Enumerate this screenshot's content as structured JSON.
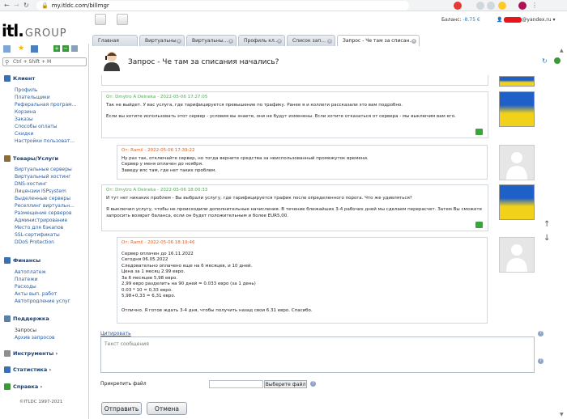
{
  "browser": {
    "url": "my.itldc.com/billmgr"
  },
  "header": {
    "logo_main": "itl.",
    "logo_group": "GROUP",
    "balance_label": "Баланс:",
    "balance_value": "-8.75 €",
    "user_email_suffix": "@yandex.ru"
  },
  "tabs": [
    {
      "label": "Главная"
    },
    {
      "label": "Виртуальны..."
    },
    {
      "label": "Виртуальны..."
    },
    {
      "label": "Профиль кл..."
    },
    {
      "label": "Список зап..."
    },
    {
      "label": "Запрос - Че там за списан..."
    }
  ],
  "sidebar": {
    "search_placeholder": "Ctrl + Shift + M",
    "sections": [
      {
        "title": "Клиент",
        "items": [
          "Профиль",
          "Плательщики",
          "Реферальная програм...",
          "Корзина",
          "Заказы",
          "Способы оплаты",
          "Скидки",
          "Настройки пользоват..."
        ]
      },
      {
        "title": "Товары/Услуги",
        "items": [
          "Виртуальные серверы",
          "Виртуальный хостинг",
          "DNS-хостинг",
          "Лицензии ISPsystem",
          "Выделенные серверы",
          "Реселлинг виртуальн...",
          "Размещение серверов",
          "Администрирование",
          "Место для бэкапов",
          "SSL-сертификаты",
          "DDoS Protection"
        ]
      },
      {
        "title": "Финансы",
        "items": [
          "Автоплатеж",
          "Платежи",
          "Расходы",
          "Акты вып. работ",
          "Автопродление услуг"
        ]
      },
      {
        "title": "Поддержка",
        "items": [
          "Запросы",
          "Архив запросов"
        ]
      },
      {
        "title": "Инструменты ›",
        "items": []
      },
      {
        "title": "Статистика ›",
        "items": []
      },
      {
        "title": "Справка ›",
        "items": []
      }
    ],
    "copyright": "©ITLDC 1997-2021"
  },
  "ticket": {
    "title": "Запрос - Че там за списания начались?",
    "messages": [
      {
        "header": "От: Dmytro A Deineka - 2022-05-06 17:27:05",
        "lines": [
          "Так не выйдет. У вас услуга, где тарифицируется превышение по трафику. Ранее я и коллеги рассказали это вам подробно.",
          "",
          "Если вы хотите использовать этот сервер - условия вы знаете, они не будут изменены. Если хотите отказаться от сервера - мы выключим вам его."
        ]
      },
      {
        "header": "От: Ramil - 2022-05-06 17:39:22",
        "lines": [
          "Ну раз так, отключайте сервер, но тогда верните средства за неиспользованный промежуток времени.",
          "Сервер у меня оплачен до ноября.",
          "Заведу впс там, где нет таких проблем."
        ]
      },
      {
        "header": "От: Dmytro A Deineka - 2022-05-06 18:00:33",
        "lines": [
          "И тут нет никаких проблем - Вы выбрали услугу, где тарифицируется трафик после определенного порога. Что же удивляться?",
          "",
          "Я выключил услугу, чтобы не происходили дополнительные начисления. В течение ближайших 3-4 рабочих дней мы сделаем перерасчет. Затем Вы сможете",
          "запросить возврат баланса, если он будет положительным и более EUR5,00."
        ]
      },
      {
        "header": "От: Ramil - 2022-05-06 18:19:46",
        "lines": [
          "Сервер оплачен до 16.11.2022",
          "Сегодня 06.05.2022",
          "Следовательно оплачено еще на 6 месяцев, и 10 дней.",
          "Цена за 1 месяц 2.99 евро.",
          "За 6 месяцев 5,98 евро.",
          "2,99 евро разделить на 90 дней = 0.033 евро (за 1 день)",
          "0.03 * 10 = 0,33 евро.",
          "5,98+0,33 = 6,31 евро.",
          "",
          "Отлично. Я готов ждать 3-4 дня, чтобы получить назад свои 6.31 евро. Спасибо."
        ]
      }
    ],
    "cite_link": "Цитировать",
    "reply_placeholder": "Текст сообщения",
    "attach_label": "Прикрепить файл",
    "choose_file": "Выберите файл",
    "submit": "Отправить",
    "cancel": "Отмена"
  },
  "colors": {
    "link": "#2a5d9f",
    "support_header": "#4caf50",
    "client_header": "#e06020",
    "balance": "#2a7ab8",
    "attach_button": "#38a63a"
  }
}
